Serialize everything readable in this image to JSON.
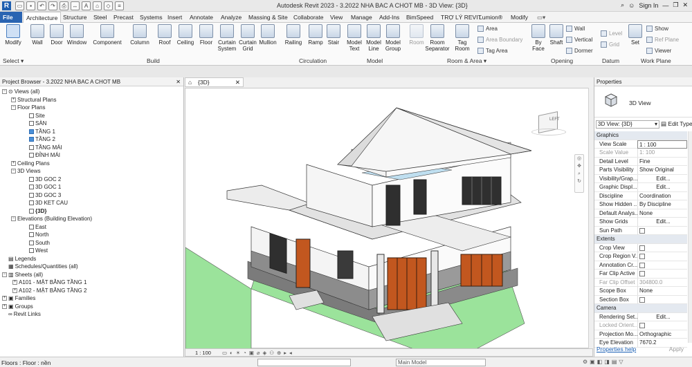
{
  "window": {
    "title": "Autodesk Revit 2023 - 3.2022 NHA BAC A CHOT MB - 3D View: {3D}",
    "sign_in": "Sign In"
  },
  "tabs": [
    "File",
    "Architecture",
    "Structure",
    "Steel",
    "Precast",
    "Systems",
    "Insert",
    "Annotate",
    "Analyze",
    "Massing & Site",
    "Collaborate",
    "View",
    "Manage",
    "Add-Ins",
    "BimSpeed",
    "TRỢ LÝ REVIT",
    "Lumion®",
    "Modify"
  ],
  "ribbon": {
    "buttons": [
      "Modify",
      "Wall",
      "Door",
      "Window",
      "Component",
      "Column",
      "Roof",
      "Ceiling",
      "Floor",
      "Curtain System",
      "Curtain Grid",
      "Mullion",
      "Railing",
      "Ramp",
      "Stair",
      "Model Text",
      "Model Line",
      "Model Group",
      "Room",
      "Room Separator",
      "Tag Room",
      "By Face",
      "Shaft",
      "Set"
    ],
    "small": {
      "area": "Area",
      "area_boundary": "Area Boundary",
      "tag_area": "Tag Area",
      "wall": "Wall",
      "vertical": "Vertical",
      "dormer": "Dormer",
      "level": "Level",
      "grid": "Grid",
      "show": "Show",
      "ref_plane": "Ref  Plane",
      "viewer": "Viewer"
    },
    "groups": {
      "select": "Select",
      "build": "Build",
      "circulation": "Circulation",
      "model": "Model",
      "room_area": "Room & Area",
      "opening": "Opening",
      "datum": "Datum",
      "work_plane": "Work Plane"
    }
  },
  "browser": {
    "title": "Project Browser - 3.2022 NHA BAC A CHOT MB",
    "nodes": [
      "Views (all)",
      "Structural Plans",
      "Floor Plans",
      "Site",
      "SÀN",
      "TẦNG 1",
      "TẦNG 2",
      "TẦNG MÁI",
      "ĐỈNH MÁI",
      "Ceiling Plans",
      "3D Views",
      "3D  GOC 2",
      "3D GOC 1",
      "3D GOC 3",
      "3D KET CAU",
      "{3D}",
      "Elevations (Building Elevation)",
      "East",
      "North",
      "South",
      "West",
      "Legends",
      "Schedules/Quantities (all)",
      "Sheets (all)",
      "A101 - MẶT BẰNG TẦNG 1",
      "A102 - MẶT BẰNG TẦNG 2",
      "Families",
      "Groups",
      "Revit Links"
    ]
  },
  "view": {
    "tab": "{3D}",
    "scale": "1 : 100",
    "viewcube_face": "LEFT"
  },
  "properties": {
    "title": "Properties",
    "type_name": "3D View",
    "filter": "3D View: {3D}",
    "edit_type": "Edit Type",
    "rows": [
      {
        "cat": "Graphics"
      },
      {
        "label": "View Scale",
        "value": "1 : 100"
      },
      {
        "label": "Scale Value",
        "value": "1:  100"
      },
      {
        "label": "Detail Level",
        "value": "Fine"
      },
      {
        "label": "Parts Visibility",
        "value": "Show Original"
      },
      {
        "label": "Visibility/Grap...",
        "value": "Edit..."
      },
      {
        "label": "Graphic Displ...",
        "value": "Edit..."
      },
      {
        "label": "Discipline",
        "value": "Coordination"
      },
      {
        "label": "Show Hidden ...",
        "value": "By Discipline"
      },
      {
        "label": "Default Analys...",
        "value": "None"
      },
      {
        "label": "Show Grids",
        "value": "Edit..."
      },
      {
        "label": "Sun Path",
        "value": ""
      },
      {
        "cat": "Extents"
      },
      {
        "label": "Crop View",
        "value": ""
      },
      {
        "label": "Crop Region V...",
        "value": ""
      },
      {
        "label": "Annotation Cr...",
        "value": ""
      },
      {
        "label": "Far Clip Active",
        "value": ""
      },
      {
        "label": "Far Clip Offset",
        "value": "304800.0"
      },
      {
        "label": "Scope Box",
        "value": "None"
      },
      {
        "label": "Section Box",
        "value": ""
      },
      {
        "cat": "Camera"
      },
      {
        "label": "Rendering Set...",
        "value": "Edit..."
      },
      {
        "label": "Locked Orient...",
        "value": ""
      },
      {
        "label": "Projection Mo...",
        "value": "Orthographic"
      },
      {
        "label": "Eye Elevation",
        "value": "7670.2"
      }
    ],
    "help": "Properties help",
    "apply": "Apply"
  },
  "status": {
    "text": "Floors : Floor : nền",
    "model": "Main Model"
  }
}
